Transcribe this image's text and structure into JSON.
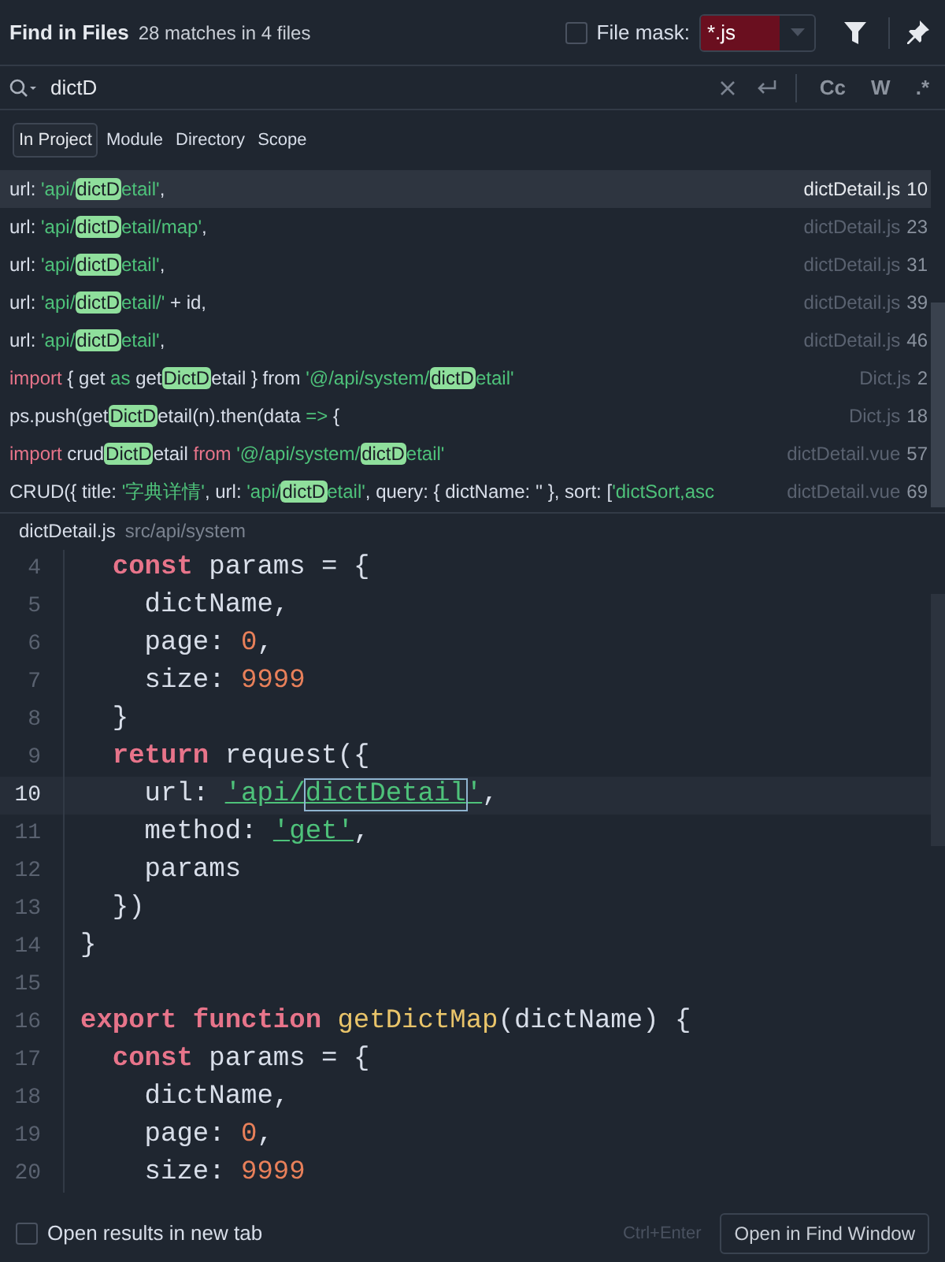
{
  "header": {
    "title": "Find in Files",
    "summary": "28 matches in 4 files",
    "file_mask": {
      "label": "File mask:",
      "checked": false,
      "value": "*.js"
    }
  },
  "search": {
    "value": "dictD",
    "toggles": [
      {
        "label": "Cc",
        "selected": false
      },
      {
        "label": "W",
        "selected": false
      },
      {
        "label": ".*",
        "selected": false
      }
    ]
  },
  "scopes": [
    {
      "label": "In Project",
      "selected": true
    },
    {
      "label": "Module",
      "selected": false
    },
    {
      "label": "Directory",
      "selected": false
    },
    {
      "label": "Scope",
      "selected": false
    }
  ],
  "results": [
    {
      "selected": true,
      "file": "dictDetail.js",
      "line": "10",
      "segments": [
        {
          "kind": "plain",
          "text": "url: "
        },
        {
          "kind": "str",
          "text": "'api/"
        },
        {
          "kind": "match",
          "text": "dictD"
        },
        {
          "kind": "str",
          "text": "etail'"
        },
        {
          "kind": "plain",
          "text": ","
        }
      ]
    },
    {
      "selected": false,
      "file": "dictDetail.js",
      "line": "23",
      "segments": [
        {
          "kind": "plain",
          "text": "url: "
        },
        {
          "kind": "str",
          "text": "'api/"
        },
        {
          "kind": "match",
          "text": "dictD"
        },
        {
          "kind": "str",
          "text": "etail/map'"
        },
        {
          "kind": "plain",
          "text": ","
        }
      ]
    },
    {
      "selected": false,
      "file": "dictDetail.js",
      "line": "31",
      "segments": [
        {
          "kind": "plain",
          "text": "url: "
        },
        {
          "kind": "str",
          "text": "'api/"
        },
        {
          "kind": "match",
          "text": "dictD"
        },
        {
          "kind": "str",
          "text": "etail'"
        },
        {
          "kind": "plain",
          "text": ","
        }
      ]
    },
    {
      "selected": false,
      "file": "dictDetail.js",
      "line": "39",
      "segments": [
        {
          "kind": "plain",
          "text": "url: "
        },
        {
          "kind": "str",
          "text": "'api/"
        },
        {
          "kind": "match",
          "text": "dictD"
        },
        {
          "kind": "str",
          "text": "etail/'"
        },
        {
          "kind": "plain",
          "text": " + id,"
        }
      ]
    },
    {
      "selected": false,
      "file": "dictDetail.js",
      "line": "46",
      "segments": [
        {
          "kind": "plain",
          "text": "url: "
        },
        {
          "kind": "str",
          "text": "'api/"
        },
        {
          "kind": "match",
          "text": "dictD"
        },
        {
          "kind": "str",
          "text": "etail'"
        },
        {
          "kind": "plain",
          "text": ","
        }
      ]
    },
    {
      "selected": false,
      "file": "Dict.js",
      "line": "2",
      "segments": [
        {
          "kind": "kw",
          "text": "import"
        },
        {
          "kind": "plain",
          "text": " { get "
        },
        {
          "kind": "str",
          "text": "as"
        },
        {
          "kind": "plain",
          "text": " get"
        },
        {
          "kind": "match",
          "text": "DictD"
        },
        {
          "kind": "plain",
          "text": "etail } from "
        },
        {
          "kind": "str",
          "text": "'@/api/system/"
        },
        {
          "kind": "match",
          "text": "dictD"
        },
        {
          "kind": "str",
          "text": "etail'"
        }
      ]
    },
    {
      "selected": false,
      "file": "Dict.js",
      "line": "18",
      "segments": [
        {
          "kind": "plain",
          "text": "ps.push(get"
        },
        {
          "kind": "match",
          "text": "DictD"
        },
        {
          "kind": "plain",
          "text": "etail(n).then(data "
        },
        {
          "kind": "str",
          "text": "=>"
        },
        {
          "kind": "plain",
          "text": " {"
        }
      ]
    },
    {
      "selected": false,
      "file": "dictDetail.vue",
      "line": "57",
      "segments": [
        {
          "kind": "kw",
          "text": "import"
        },
        {
          "kind": "plain",
          "text": " crud"
        },
        {
          "kind": "match",
          "text": "DictD"
        },
        {
          "kind": "plain",
          "text": "etail "
        },
        {
          "kind": "kw",
          "text": "from"
        },
        {
          "kind": "str",
          "text": " '@/api/system/"
        },
        {
          "kind": "match",
          "text": "dictD"
        },
        {
          "kind": "str",
          "text": "etail'"
        }
      ]
    },
    {
      "selected": false,
      "file": "dictDetail.vue",
      "line": "69",
      "segments": [
        {
          "kind": "plain",
          "text": "CRUD({ title: "
        },
        {
          "kind": "str",
          "text": "'字典详情'"
        },
        {
          "kind": "plain",
          "text": ", url: "
        },
        {
          "kind": "str",
          "text": "'api/"
        },
        {
          "kind": "match",
          "text": "dictD"
        },
        {
          "kind": "str",
          "text": "etail'"
        },
        {
          "kind": "plain",
          "text": ", query: { dictName: '' }, sort: ["
        },
        {
          "kind": "str",
          "text": "'dictSort,asc"
        }
      ]
    }
  ],
  "preview": {
    "file": "dictDetail.js",
    "path": "src/api/system",
    "lines": [
      {
        "number": "4",
        "current": false,
        "segments": [
          {
            "kind": "kw",
            "text": "  const"
          },
          {
            "kind": "plain",
            "text": " params = {"
          }
        ]
      },
      {
        "number": "5",
        "current": false,
        "segments": [
          {
            "kind": "plain",
            "text": "    dictName,"
          }
        ]
      },
      {
        "number": "6",
        "current": false,
        "segments": [
          {
            "kind": "plain",
            "text": "    page: "
          },
          {
            "kind": "num",
            "text": "0"
          },
          {
            "kind": "plain",
            "text": ","
          }
        ]
      },
      {
        "number": "7",
        "current": false,
        "segments": [
          {
            "kind": "plain",
            "text": "    size: "
          },
          {
            "kind": "num",
            "text": "9999"
          }
        ]
      },
      {
        "number": "8",
        "current": false,
        "segments": [
          {
            "kind": "plain",
            "text": "  }"
          }
        ]
      },
      {
        "number": "9",
        "current": false,
        "segments": [
          {
            "kind": "kw",
            "text": "  return"
          },
          {
            "kind": "plain",
            "text": " request({"
          }
        ]
      },
      {
        "number": "10",
        "current": true,
        "segments": [
          {
            "kind": "plain",
            "text": "    url: "
          },
          {
            "kind": "str",
            "text": "'api/"
          },
          {
            "kind": "match",
            "text": "dictDetail"
          },
          {
            "kind": "str",
            "text": "'"
          },
          {
            "kind": "plain",
            "text": ","
          }
        ]
      },
      {
        "number": "11",
        "current": false,
        "segments": [
          {
            "kind": "plain",
            "text": "    method: "
          },
          {
            "kind": "str",
            "text": "'get'"
          },
          {
            "kind": "plain",
            "text": ","
          }
        ]
      },
      {
        "number": "12",
        "current": false,
        "segments": [
          {
            "kind": "plain",
            "text": "    params"
          }
        ]
      },
      {
        "number": "13",
        "current": false,
        "segments": [
          {
            "kind": "plain",
            "text": "  })"
          }
        ]
      },
      {
        "number": "14",
        "current": false,
        "segments": [
          {
            "kind": "plain",
            "text": "}"
          }
        ]
      },
      {
        "number": "15",
        "current": false
      },
      {
        "number": "16",
        "current": false,
        "segments": [
          {
            "kind": "kw",
            "text": "export function"
          },
          {
            "kind": "fn",
            "text": " getDictMap"
          },
          {
            "kind": "plain",
            "text": "(dictName) {"
          }
        ]
      },
      {
        "number": "17",
        "current": false,
        "segments": [
          {
            "kind": "kw",
            "text": "  const"
          },
          {
            "kind": "plain",
            "text": " params = {"
          }
        ]
      },
      {
        "number": "18",
        "current": false,
        "segments": [
          {
            "kind": "plain",
            "text": "    dictName,"
          }
        ]
      },
      {
        "number": "19",
        "current": false,
        "segments": [
          {
            "kind": "plain",
            "text": "    page: "
          },
          {
            "kind": "num",
            "text": "0"
          },
          {
            "kind": "plain",
            "text": ","
          }
        ]
      },
      {
        "number": "20",
        "current": false,
        "segments": [
          {
            "kind": "plain",
            "text": "    size: "
          },
          {
            "kind": "num",
            "text": "9999"
          }
        ]
      }
    ]
  },
  "footer": {
    "new_tab": {
      "label": "Open results in new tab",
      "checked": false
    },
    "shortcut": "Ctrl+Enter",
    "button": "Open in Find Window"
  }
}
